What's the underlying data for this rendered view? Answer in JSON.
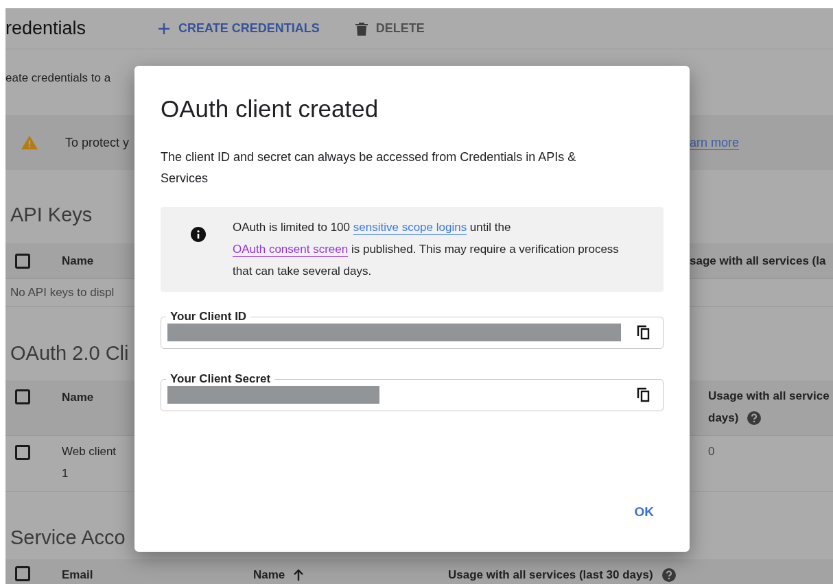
{
  "page": {
    "title": "redentials",
    "actions": [
      {
        "kind": "create",
        "label": "CREATE CREDENTIALS"
      },
      {
        "kind": "delete",
        "label": "DELETE"
      }
    ],
    "intro": "eate credentials to a",
    "alert": {
      "text": "To protect y",
      "link": "arn more"
    },
    "api_keys": {
      "title": "API Keys",
      "header_checked": false,
      "columns": [
        "Name",
        "sage with all services (la"
      ],
      "empty": "No API keys to displ"
    },
    "oauth_clients": {
      "title": "OAuth 2.0 Cli",
      "header_checked": false,
      "columns": [
        [
          "Name"
        ],
        [
          "Usage with all service",
          "days)"
        ]
      ],
      "rows": [
        {
          "checked": false,
          "name": [
            "Web client",
            "1"
          ],
          "usage": "0"
        }
      ]
    },
    "service_accounts": {
      "title": "Service Acco",
      "header_checked": false,
      "columns": [
        {
          "label": "Email",
          "sorted": false
        },
        {
          "label": "Name",
          "sorted": true
        },
        {
          "label": "Usage with all services (last 30 days)",
          "sorted": false
        }
      ]
    }
  },
  "dialog": {
    "title": "OAuth client created",
    "description": "The client ID and secret can always be accessed from Credentials in APIs & Services",
    "notice": [
      {
        "kind": "text",
        "text": "OAuth is limited to 100 "
      },
      {
        "kind": "link",
        "visited": false,
        "text": "sensitive scope logins"
      },
      {
        "kind": "text",
        "text": " until the "
      },
      {
        "kind": "link",
        "visited": true,
        "text": "OAuth consent screen"
      },
      {
        "kind": "text",
        "text": " is published. This may require a verification process that can take several days."
      }
    ],
    "fields": [
      {
        "label": "Your Client ID",
        "kind": "id"
      },
      {
        "label": "Your Client Secret",
        "kind": "secret"
      }
    ],
    "button": "OK"
  }
}
